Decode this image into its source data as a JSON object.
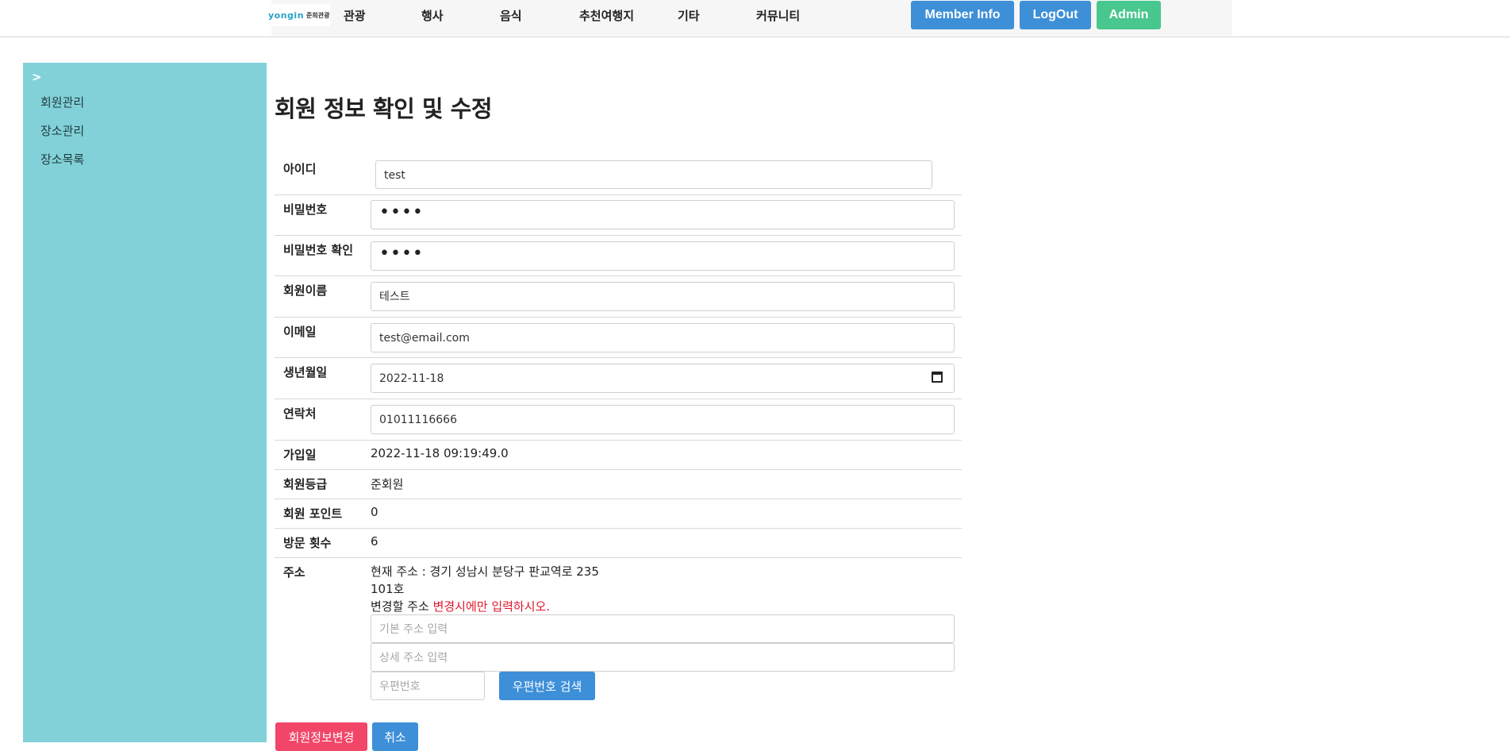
{
  "header": {
    "logo_mark": "yongin",
    "logo_text": "준희관광",
    "nav": [
      "관광",
      "행사",
      "음식",
      "추천여행지",
      "기타",
      "커뮤니티"
    ],
    "member_info": "Member Info",
    "logout": "LogOut",
    "admin": "Admin"
  },
  "sidebar": {
    "arrow": ">",
    "items": [
      "회원관리",
      "장소관리",
      "장소목록"
    ]
  },
  "page": {
    "title": "회원 정보 확인 및 수정"
  },
  "form": {
    "id": {
      "label": "아이디",
      "value": "test"
    },
    "password": {
      "label": "비밀번호",
      "value": "••••"
    },
    "password_confirm": {
      "label": "비밀번호 확인",
      "value": "••••"
    },
    "name": {
      "label": "회원이름",
      "value": "테스트"
    },
    "email": {
      "label": "이메일",
      "value": "test@email.com"
    },
    "birth": {
      "label": "생년월일",
      "value": "2022-11-18"
    },
    "phone": {
      "label": "연락처",
      "value": "01011116666"
    },
    "joined": {
      "label": "가입일",
      "value": "2022-11-18 09:19:49.0"
    },
    "grade": {
      "label": "회원등급",
      "value": "준회원"
    },
    "points": {
      "label": "회원 포인트",
      "value": "0"
    },
    "visits": {
      "label": "방문 횟수",
      "value": "6"
    },
    "address": {
      "label": "주소",
      "current_line1": "현재 주소 : 경기 성남시 분당구 판교역로 235",
      "current_line2": "101호",
      "change_label": "변경할 주소",
      "change_note": "변경시에만 입력하시오.",
      "base_placeholder": "기본 주소 입력",
      "detail_placeholder": "상세 주소 입력",
      "zip_placeholder": "우편번호",
      "zip_search": "우편번호 검색"
    }
  },
  "actions": {
    "submit": "회원정보변경",
    "cancel": "취소"
  },
  "colors": {
    "sidebar": "#82d1d8",
    "member_info_btn": "#3d8fd8",
    "logout_btn": "#3d8fd8",
    "admin_btn": "#48c78e",
    "submit_btn": "#f14668",
    "cancel_btn": "#3d8fd8",
    "note_red": "#e0162b"
  }
}
